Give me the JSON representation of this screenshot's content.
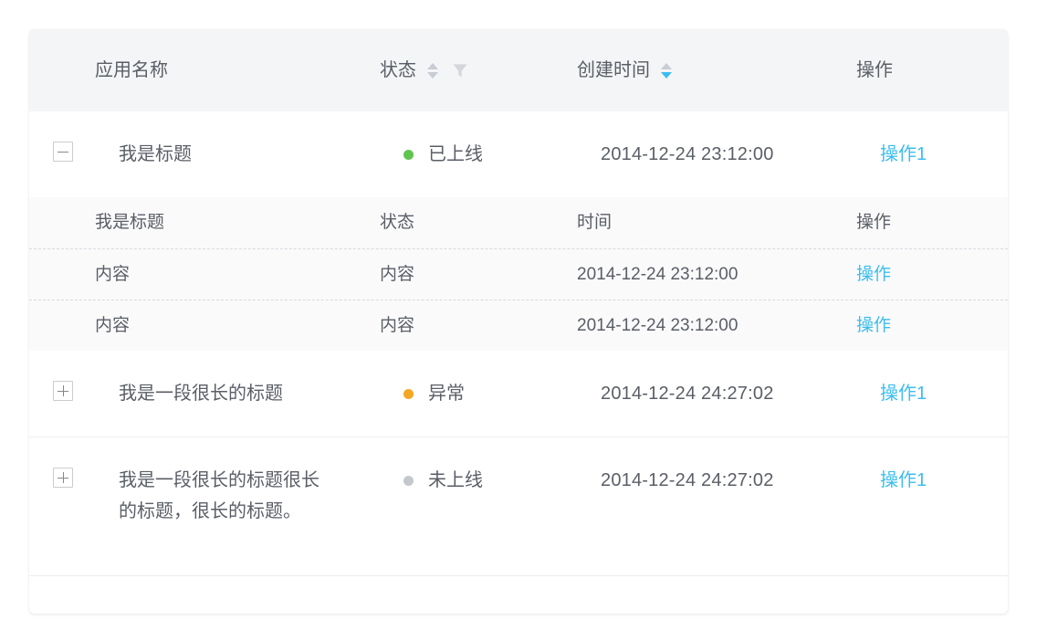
{
  "table": {
    "columns": [
      {
        "key": "toggle",
        "label": "",
        "sortable": false,
        "filterable": false
      },
      {
        "key": "name",
        "label": "应用名称",
        "sortable": false,
        "filterable": false
      },
      {
        "key": "status",
        "label": "状态",
        "sortable": true,
        "filterable": true,
        "sort_state": "none"
      },
      {
        "key": "created",
        "label": "创建时间",
        "sortable": true,
        "filterable": false,
        "sort_state": "desc"
      },
      {
        "key": "action",
        "label": "操作",
        "sortable": false,
        "filterable": false
      }
    ],
    "icons": {
      "sort": "sort-caret-icon",
      "filter": "funnel-filter-icon",
      "expand": "square-plus-icon",
      "collapse": "square-minus-icon",
      "status_dot": "status-dot-icon"
    },
    "colors": {
      "header_bg": "#f4f5f6",
      "link": "#3cbdf0",
      "sort_active": "#3cbdf0",
      "sort_inactive": "#c8ccd4",
      "text": "#5a5e66",
      "status_online": "#5fc54e",
      "status_error": "#f5a623",
      "status_offline": "#c4c7cc",
      "subtable_bg": "#fafafa",
      "row_border": "#eceef1",
      "dashed_border": "#d7dade"
    },
    "rows": [
      {
        "expanded": true,
        "toggle_icon": "square-minus-icon",
        "name": "我是标题",
        "status": {
          "label": "已上线",
          "color": "#5fc54e"
        },
        "created": "2014-12-24  23:12:00",
        "action": "操作1"
      },
      {
        "expanded": false,
        "toggle_icon": "square-plus-icon",
        "name": "我是一段很长的标题",
        "status": {
          "label": "异常",
          "color": "#f5a623"
        },
        "created": "2014-12-24  24:27:02",
        "action": "操作1"
      },
      {
        "expanded": false,
        "toggle_icon": "square-plus-icon",
        "name": "我是一段很长的标题很长的标题，很长的标题。",
        "status": {
          "label": "未上线",
          "color": "#c4c7cc"
        },
        "created": "2014-12-24  24:27:02",
        "action": "操作1"
      }
    ],
    "subtable": {
      "header": {
        "name": "我是标题",
        "status": "状态",
        "created": "时间",
        "action": "操作"
      },
      "rows": [
        {
          "name": "内容",
          "status": "内容",
          "created": "2014-12-24  23:12:00",
          "action": "操作"
        },
        {
          "name": "内容",
          "status": "内容",
          "created": "2014-12-24  23:12:00",
          "action": "操作"
        }
      ]
    }
  }
}
